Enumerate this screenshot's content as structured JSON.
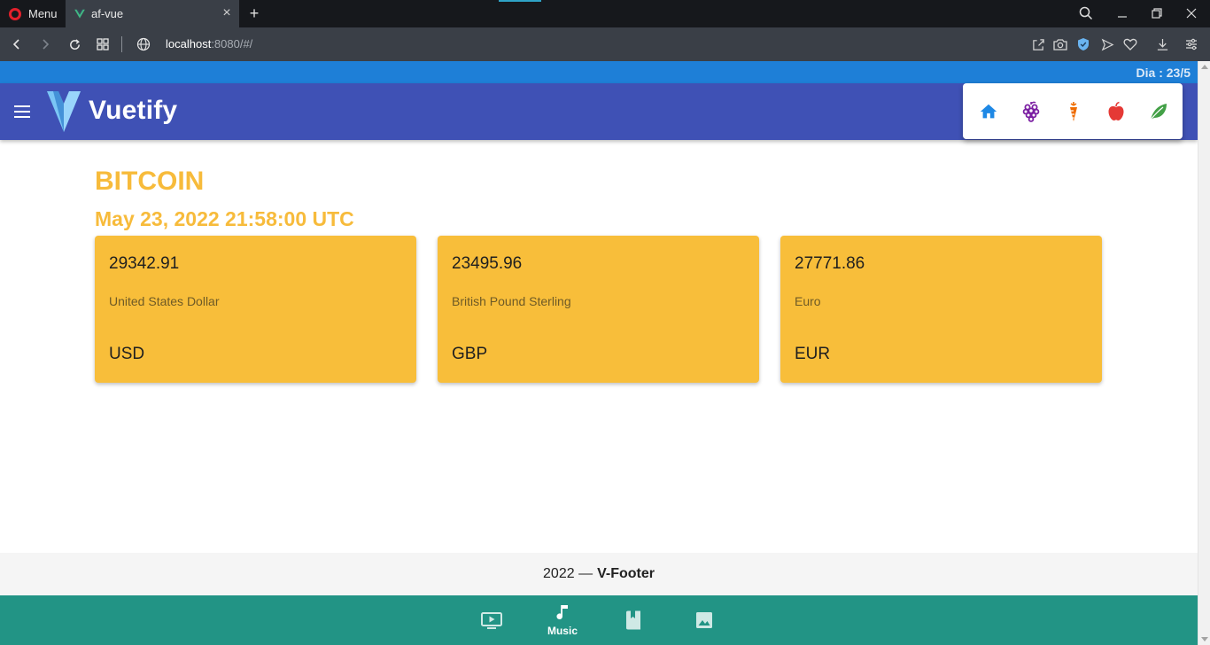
{
  "browser": {
    "menu_label": "Menu",
    "tab_title": "af-vue",
    "url_host": "localhost",
    "url_rest": ":8080/#/"
  },
  "app": {
    "day_label": "Dia : 23/5",
    "brand": "Vuetify",
    "nav_icons": [
      "home-icon",
      "grapes-icon",
      "carrot-icon",
      "apple-icon",
      "leaf-icon"
    ],
    "title": "BITCOIN",
    "updated": "May 23, 2022 21:58:00 UTC",
    "rates": [
      {
        "rate": "29342.91",
        "description": "United States Dollar",
        "code": "USD"
      },
      {
        "rate": "23495.96",
        "description": "British Pound Sterling",
        "code": "GBP"
      },
      {
        "rate": "27771.86",
        "description": "Euro",
        "code": "EUR"
      }
    ],
    "footer": {
      "year": "2022 —",
      "name": "V-Footer"
    },
    "bottom_nav": [
      {
        "icon": "video-icon",
        "label": ""
      },
      {
        "icon": "music-note-icon",
        "label": "Music"
      },
      {
        "icon": "book-icon",
        "label": ""
      },
      {
        "icon": "image-icon",
        "label": ""
      }
    ]
  },
  "colors": {
    "app_bar": "#3f51b5",
    "top_strip": "#1e7fd7",
    "accent": "#f7bb3b",
    "card": "#f8be3a",
    "bottom_nav": "#229485",
    "home_icon": "#1e88e5",
    "grapes_icon": "#7b1fa2",
    "carrot_icon": "#ef6c00",
    "apple_icon": "#e53935",
    "leaf_icon": "#43a047"
  }
}
